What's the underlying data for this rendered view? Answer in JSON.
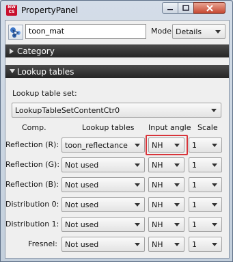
{
  "window": {
    "title": "PropertyPanel",
    "app_icon_text": [
      "NW",
      "CS"
    ],
    "icons": {
      "app": "nw-cs-logo",
      "minimize": "minimize-icon",
      "maximize": "maximize-icon",
      "close": "close-icon"
    }
  },
  "header": {
    "object_icon": "material-nodes-icon",
    "name_value": "toon_mat",
    "mode_label": "Mode:",
    "mode_value": "Details"
  },
  "sections": {
    "category": {
      "label": "Category",
      "expanded": false
    },
    "lookup": {
      "label": "Lookup tables",
      "expanded": true
    }
  },
  "lookup": {
    "set_label": "Lookup table set:",
    "set_value": "LookupTableSetContentCtr0",
    "columns": [
      "Comp.",
      "Lookup tables",
      "Input angle",
      "Scale"
    ],
    "rows": [
      {
        "comp": "Reflection (R):",
        "table": "toon_reflectance",
        "angle": "NH",
        "scale": "1"
      },
      {
        "comp": "Reflection (G):",
        "table": "Not used",
        "angle": "NH",
        "scale": "1"
      },
      {
        "comp": "Reflection (B):",
        "table": "Not used",
        "angle": "NH",
        "scale": "1"
      },
      {
        "comp": "Distribution 0:",
        "table": "Not used",
        "angle": "NH",
        "scale": "1"
      },
      {
        "comp": "Distribution 1:",
        "table": "Not used",
        "angle": "NH",
        "scale": "1"
      },
      {
        "comp": "Fresnel:",
        "table": "Not used",
        "angle": "NH",
        "scale": "1"
      }
    ]
  },
  "colors": {
    "highlight": "#d8343a",
    "section_header": "#2f2f2f",
    "close_button": "#c74a33"
  }
}
